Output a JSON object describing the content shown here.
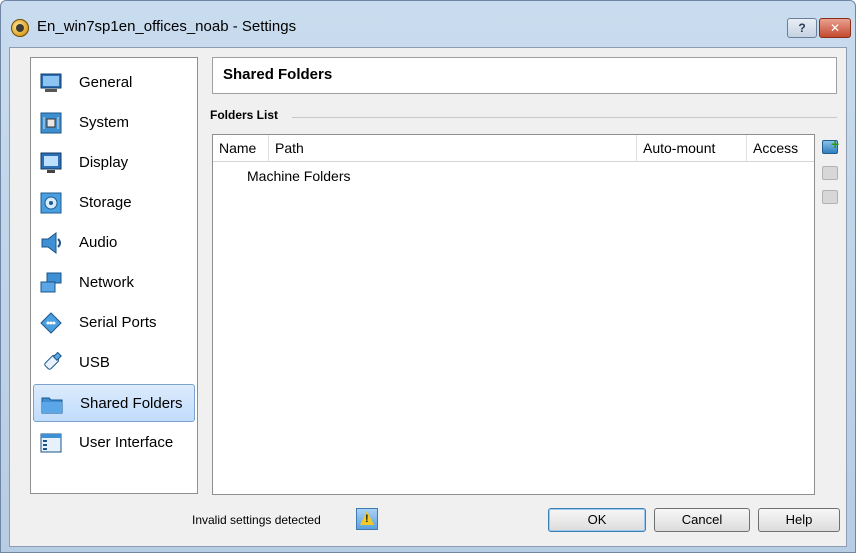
{
  "window": {
    "title": "En_win7sp1en_offices_noab - Settings",
    "help_button": "?",
    "close_button": "✕"
  },
  "sidebar": {
    "items": [
      {
        "label": "General",
        "icon": "general-icon"
      },
      {
        "label": "System",
        "icon": "system-icon"
      },
      {
        "label": "Display",
        "icon": "display-icon"
      },
      {
        "label": "Storage",
        "icon": "storage-icon"
      },
      {
        "label": "Audio",
        "icon": "audio-icon"
      },
      {
        "label": "Network",
        "icon": "network-icon"
      },
      {
        "label": "Serial Ports",
        "icon": "serial-ports-icon"
      },
      {
        "label": "USB",
        "icon": "usb-icon"
      },
      {
        "label": "Shared Folders",
        "icon": "shared-folders-icon",
        "selected": true
      },
      {
        "label": "User Interface",
        "icon": "user-interface-icon"
      }
    ]
  },
  "page": {
    "title": "Shared Folders",
    "group_label": "Folders List"
  },
  "table": {
    "columns": [
      "Name",
      "Path",
      "Auto-mount",
      "Access"
    ],
    "rows": [
      "Machine Folders"
    ]
  },
  "footer": {
    "status": "Invalid settings detected",
    "ok_label": "OK",
    "cancel_label": "Cancel",
    "help_label": "Help"
  },
  "colors": {
    "selection": "#c1dcfc",
    "window_frame": "#b7cde4"
  }
}
